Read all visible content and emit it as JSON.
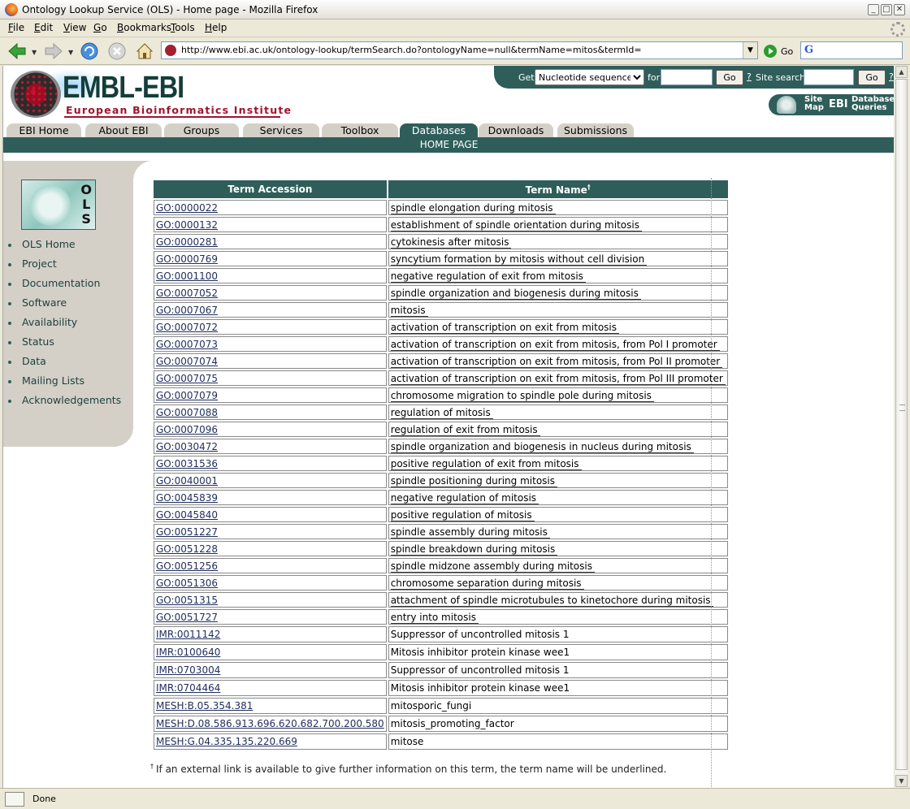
{
  "window": {
    "title": "Ontology Lookup Service (OLS) - Home page - Mozilla Firefox",
    "status": "Done"
  },
  "menu": [
    {
      "label": "File",
      "key": "F",
      "rest": "ile"
    },
    {
      "label": "Edit",
      "key": "E",
      "rest": "dit"
    },
    {
      "label": "View",
      "key": "V",
      "rest": "iew"
    },
    {
      "label": "Go",
      "key": "G",
      "rest": "o"
    },
    {
      "label": "Bookmarks",
      "key": "B",
      "rest": "ookmarks"
    },
    {
      "label": "Tools",
      "key": "T",
      "rest": "ools"
    },
    {
      "label": "Help",
      "key": "H",
      "rest": "elp"
    }
  ],
  "navbar": {
    "url": "http://www.ebi.ac.uk/ontology-lookup/termSearch.do?ontologyName=null&termName=mitos&termId=",
    "go_label": "Go",
    "search_engine": "G"
  },
  "header": {
    "logo_main": "EMBL-EBI",
    "logo_sub": "European Bioinformatics Institute",
    "get_label": "Get",
    "get_select": "Nucleotide sequences",
    "for_label": "for",
    "go_button": "Go",
    "help_mark": "?",
    "site_search_label": "Site search",
    "sitemap_line1": "Site",
    "sitemap_line2": "Map",
    "ebi_badge": "EBI",
    "dbq_line1": "Database",
    "dbq_line2": "Queries"
  },
  "tabs": [
    "EBI Home",
    "About EBI",
    "Groups",
    "Services",
    "Toolbox",
    "Databases",
    "Downloads",
    "Submissions"
  ],
  "active_tab": "Databases",
  "subbar": "HOME PAGE",
  "sidebar": {
    "logo_letters": [
      "O",
      "L",
      "S"
    ],
    "items": [
      "OLS Home",
      "Project",
      "Documentation",
      "Software",
      "Availability",
      "Status",
      "Data",
      "Mailing Lists",
      "Acknowledgements"
    ]
  },
  "results": {
    "headers": {
      "accession": "Term Accession",
      "name": "Term Name",
      "dagger": "†"
    },
    "rows": [
      {
        "acc": "GO:0000022",
        "name": "spindle elongation during mitosis",
        "ext": true
      },
      {
        "acc": "GO:0000132",
        "name": "establishment of spindle orientation during mitosis",
        "ext": true
      },
      {
        "acc": "GO:0000281",
        "name": "cytokinesis after mitosis",
        "ext": true
      },
      {
        "acc": "GO:0000769",
        "name": "syncytium formation by mitosis without cell division",
        "ext": true
      },
      {
        "acc": "GO:0001100",
        "name": "negative regulation of exit from mitosis",
        "ext": true
      },
      {
        "acc": "GO:0007052",
        "name": "spindle organization and biogenesis during mitosis",
        "ext": true
      },
      {
        "acc": "GO:0007067",
        "name": "mitosis",
        "ext": true
      },
      {
        "acc": "GO:0007072",
        "name": "activation of transcription on exit from mitosis",
        "ext": true
      },
      {
        "acc": "GO:0007073",
        "name": "activation of transcription on exit from mitosis, from Pol I promoter",
        "ext": true
      },
      {
        "acc": "GO:0007074",
        "name": "activation of transcription on exit from mitosis, from Pol II promoter",
        "ext": true
      },
      {
        "acc": "GO:0007075",
        "name": "activation of transcription on exit from mitosis, from Pol III promoter",
        "ext": true
      },
      {
        "acc": "GO:0007079",
        "name": "chromosome migration to spindle pole during mitosis",
        "ext": true
      },
      {
        "acc": "GO:0007088",
        "name": "regulation of mitosis",
        "ext": true
      },
      {
        "acc": "GO:0007096",
        "name": "regulation of exit from mitosis",
        "ext": true
      },
      {
        "acc": "GO:0030472",
        "name": "spindle organization and biogenesis in nucleus during mitosis",
        "ext": true
      },
      {
        "acc": "GO:0031536",
        "name": "positive regulation of exit from mitosis",
        "ext": true
      },
      {
        "acc": "GO:0040001",
        "name": "spindle positioning during mitosis",
        "ext": true
      },
      {
        "acc": "GO:0045839",
        "name": "negative regulation of mitosis",
        "ext": true
      },
      {
        "acc": "GO:0045840",
        "name": "positive regulation of mitosis",
        "ext": true
      },
      {
        "acc": "GO:0051227",
        "name": "spindle assembly during mitosis",
        "ext": true
      },
      {
        "acc": "GO:0051228",
        "name": "spindle breakdown during mitosis",
        "ext": true
      },
      {
        "acc": "GO:0051256",
        "name": "spindle midzone assembly during mitosis",
        "ext": true
      },
      {
        "acc": "GO:0051306",
        "name": "chromosome separation during mitosis",
        "ext": true
      },
      {
        "acc": "GO:0051315",
        "name": "attachment of spindle microtubules to kinetochore during mitosis",
        "ext": true
      },
      {
        "acc": "GO:0051727",
        "name": "entry into mitosis",
        "ext": true
      },
      {
        "acc": "IMR:0011142",
        "name": "Suppressor of uncontrolled mitosis 1",
        "ext": false
      },
      {
        "acc": "IMR:0100640",
        "name": "Mitosis inhibitor protein kinase wee1",
        "ext": false
      },
      {
        "acc": "IMR:0703004",
        "name": "Suppressor of uncontrolled mitosis 1",
        "ext": false
      },
      {
        "acc": "IMR:0704464",
        "name": "Mitosis inhibitor protein kinase wee1",
        "ext": false
      },
      {
        "acc": "MESH:B.05.354.381",
        "name": "mitosporic_fungi",
        "ext": false
      },
      {
        "acc": "MESH:D.08.586.913.696.620.682.700.200.580",
        "name": "mitosis_promoting_factor",
        "ext": false
      },
      {
        "acc": "MESH:G.04.335.135.220.669",
        "name": "mitose",
        "ext": false
      }
    ]
  },
  "footnote": {
    "mark": "†",
    "text": "If an external link is available to give further information on this term, the term name will be underlined."
  }
}
